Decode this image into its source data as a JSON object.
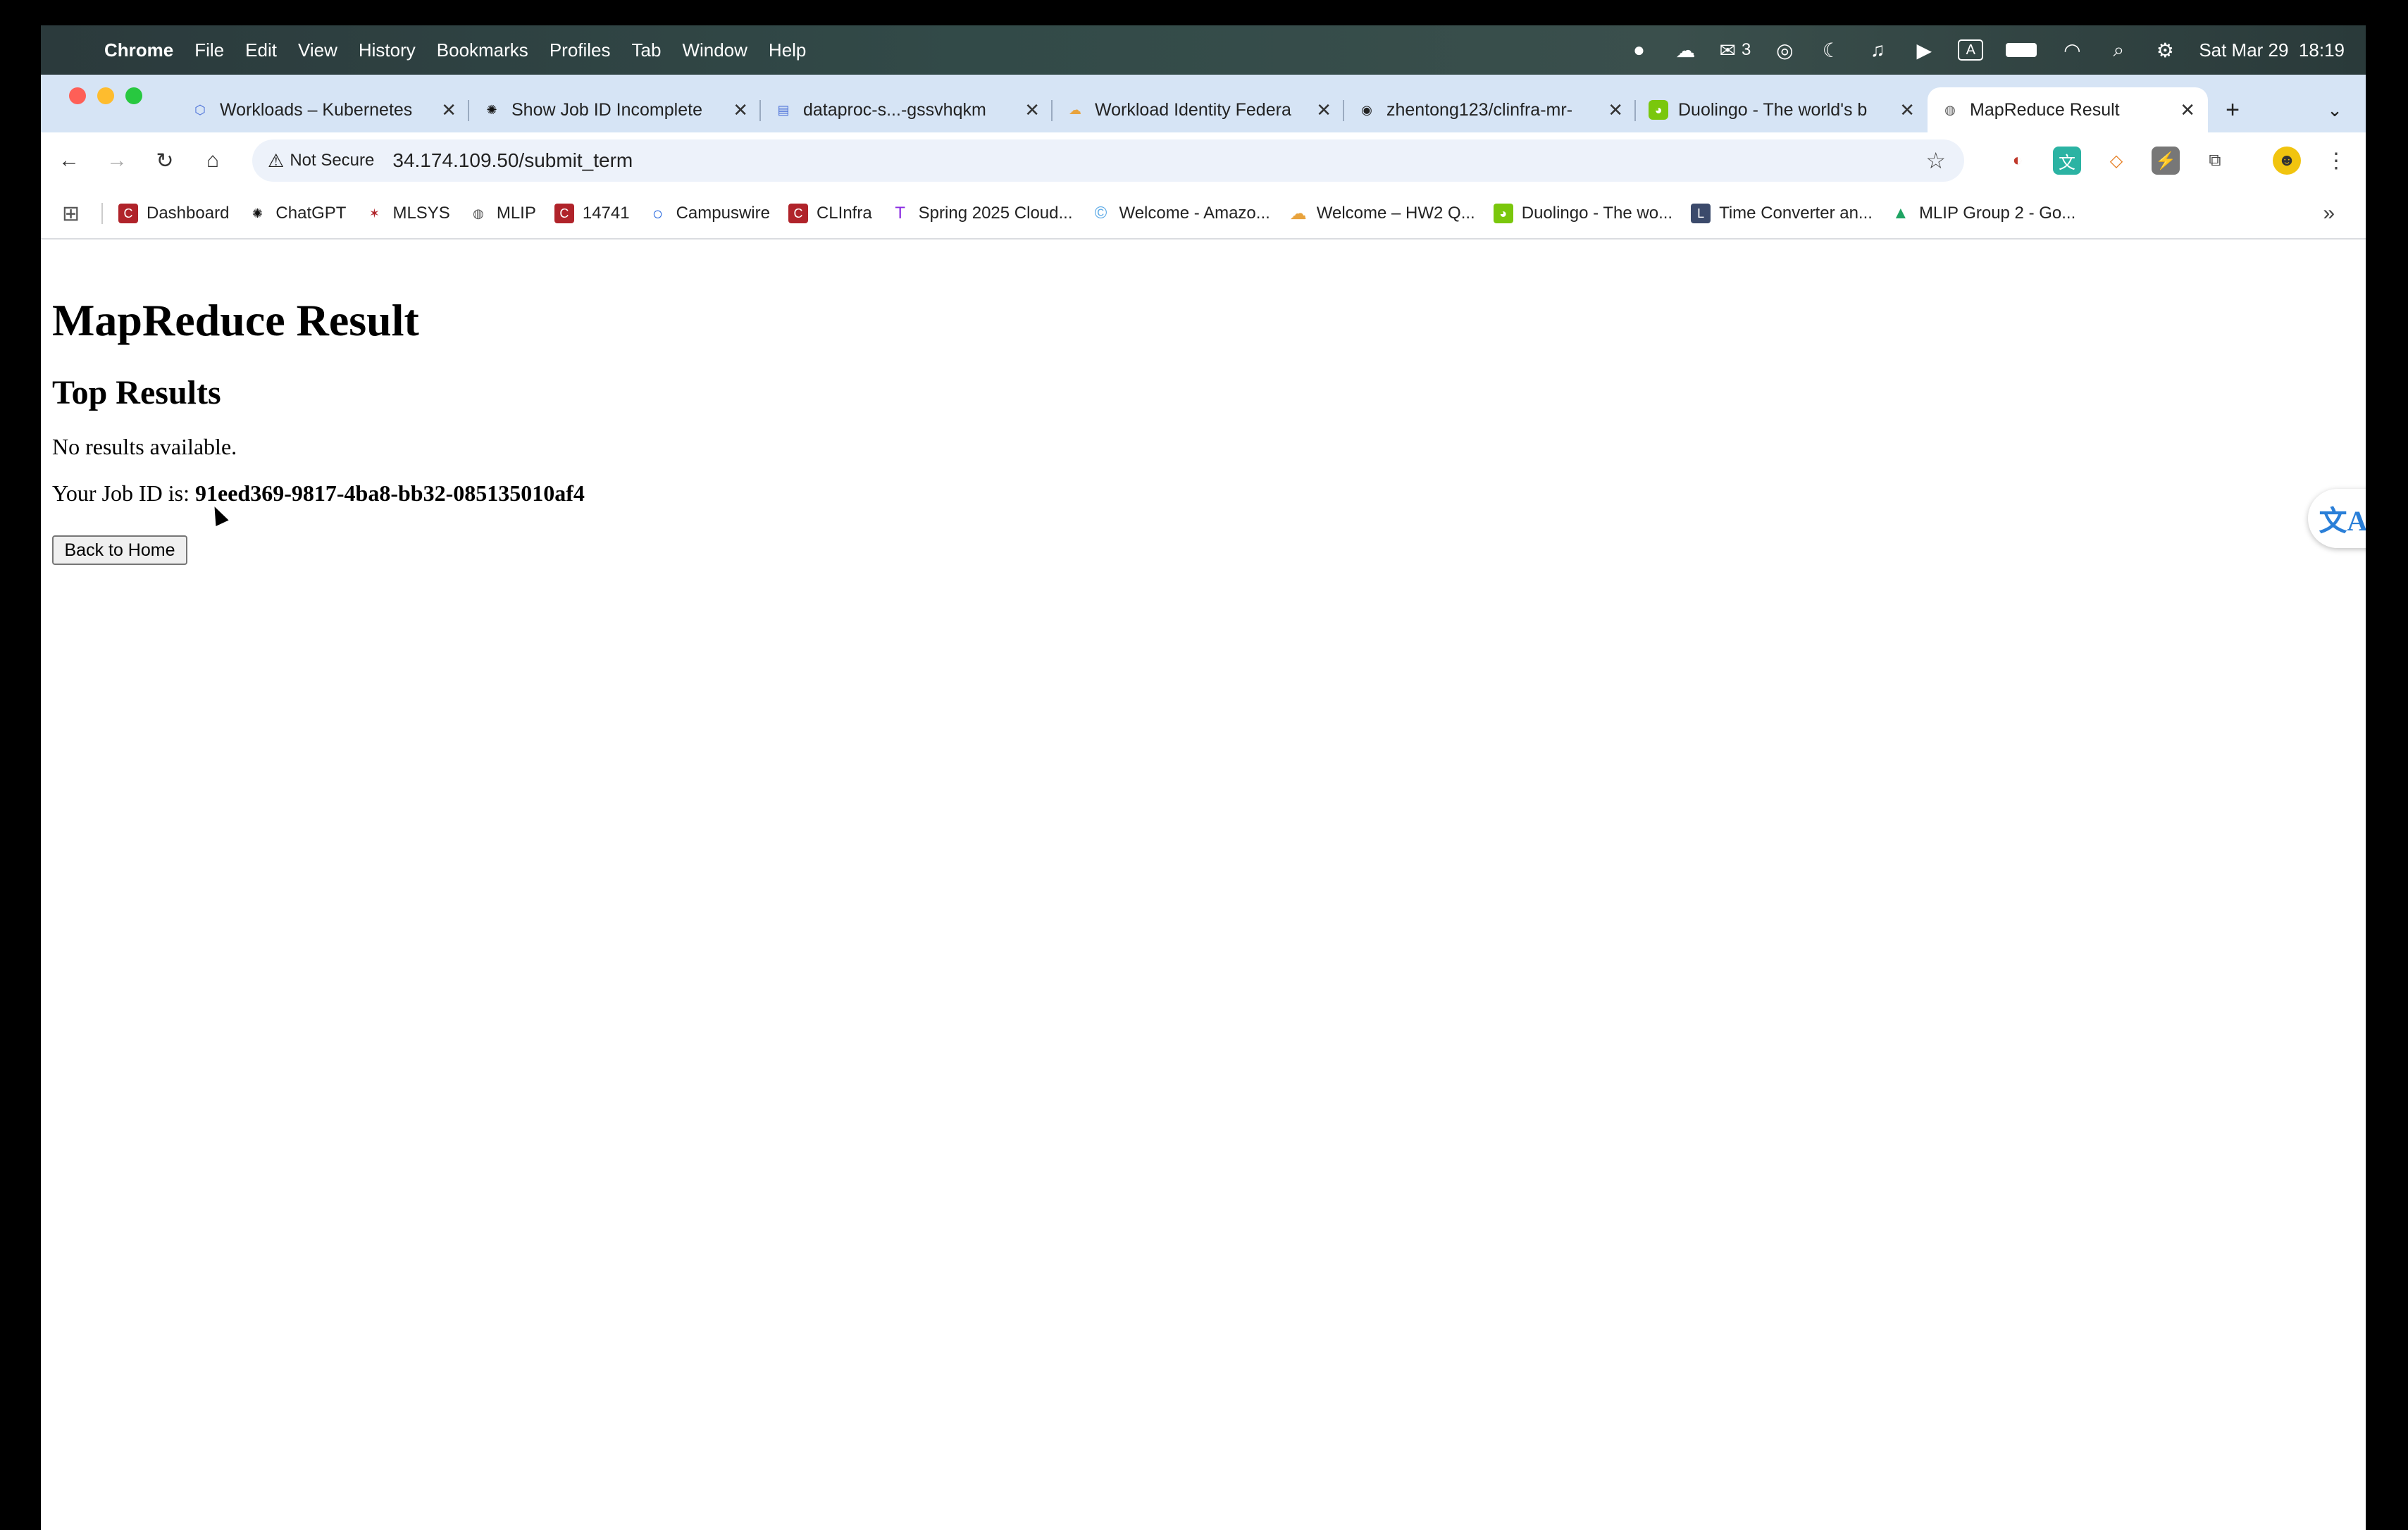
{
  "menubar": {
    "app_name": "Chrome",
    "items": [
      "File",
      "Edit",
      "View",
      "History",
      "Bookmarks",
      "Profiles",
      "Tab",
      "Window",
      "Help"
    ],
    "wechat_badge": "3",
    "datetime": "Sat Mar 29  18:19"
  },
  "tabs": [
    {
      "title": "Workloads – Kubernetes",
      "icon": "gke-icon",
      "color": "#4a6fd8"
    },
    {
      "title": "Show Job ID Incomplete",
      "icon": "openai-icon",
      "color": "#111111"
    },
    {
      "title": "dataproc-s...-gssvhqkm",
      "icon": "dataproc-icon",
      "color": "#4a6fd8"
    },
    {
      "title": "Workload Identity Federa",
      "icon": "gcloud-icon",
      "color": "#e8a33d"
    },
    {
      "title": "zhentong123/clinfra-mr-",
      "icon": "github-icon",
      "color": "#222222"
    },
    {
      "title": "Duolingo - The world's b",
      "icon": "duolingo-icon",
      "color": "#7ac70c"
    },
    {
      "title": "MapReduce Result",
      "icon": "globe-icon",
      "color": "#555555"
    }
  ],
  "toolbar": {
    "security_label": "Not Secure",
    "url": "34.174.109.50/submit_term"
  },
  "bookmarks": [
    {
      "label": "Dashboard",
      "icon": "canvas-icon",
      "color": "#b0232a"
    },
    {
      "label": "ChatGPT",
      "icon": "openai-icon",
      "color": "#111111"
    },
    {
      "label": "MLSYS",
      "icon": "cmu-icon",
      "color": "#b0232a"
    },
    {
      "label": "MLIP",
      "icon": "globe-icon",
      "color": "#555555"
    },
    {
      "label": "14741",
      "icon": "canvas-icon",
      "color": "#b0232a"
    },
    {
      "label": "Campuswire",
      "icon": "campuswire-icon",
      "color": "#2d6cdf"
    },
    {
      "label": "CLInfra",
      "icon": "canvas-icon",
      "color": "#b0232a"
    },
    {
      "label": "Spring 2025 Cloud...",
      "icon": "theory-icon",
      "color": "#8a2be2"
    },
    {
      "label": "Welcome - Amazo...",
      "icon": "aws-icon",
      "color": "#5aa9e6"
    },
    {
      "label": "Welcome – HW2 Q...",
      "icon": "gcloud-icon",
      "color": "#e8a33d"
    },
    {
      "label": "Duolingo - The wo...",
      "icon": "duolingo-icon",
      "color": "#7ac70c"
    },
    {
      "label": "Time Converter an...",
      "icon": "clock-icon",
      "color": "#3b4a6b"
    },
    {
      "label": "MLIP Group 2 - Go...",
      "icon": "drive-icon",
      "color": "#1fa463"
    }
  ],
  "page": {
    "title": "MapReduce Result",
    "subtitle": "Top Results",
    "no_results": "No results available.",
    "job_id_prefix": "Your Job ID is: ",
    "job_id": "91eed369-9817-4ba8-bb32-085135010af4",
    "home_button": "Back to Home"
  }
}
